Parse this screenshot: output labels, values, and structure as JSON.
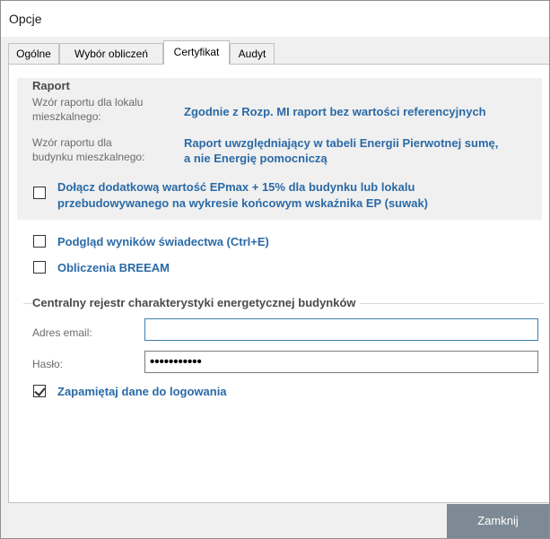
{
  "window": {
    "title": "Opcje"
  },
  "tabs": [
    {
      "label": "Ogólne"
    },
    {
      "label": "Wybór obliczeń"
    },
    {
      "label": "Certyfikat"
    },
    {
      "label": "Audyt"
    }
  ],
  "active_tab": "Certyfikat",
  "raport": {
    "title": "Raport",
    "lokal_label_line1": "Wzór raportu dla lokalu",
    "lokal_label_line2": "mieszkalnego:",
    "lokal_value": "Zgodnie z Rozp. MI raport bez wartości referencyjnych",
    "budynek_label_line1": "Wzór raportu dla",
    "budynek_label_line2": "budynku mieszkalnego:",
    "budynek_value_line1": "Raport uwzględniający w tabeli Energii Pierwotnej sumę,",
    "budynek_value_line2": "a nie Energię pomocniczą",
    "epmax_checkbox": {
      "label_line1": "Dołącz dodatkową wartość EPmax + 15% dla budynku lub lokalu",
      "label_line2": "przebudowywanego na wykresie końcowym wskaźnika EP (suwak)",
      "checked": false
    }
  },
  "preview_checkbox": {
    "label": "Podgląd wyników świadectwa (Ctrl+E)",
    "checked": false
  },
  "breeam_checkbox": {
    "label": "Obliczenia BREEAM",
    "checked": false
  },
  "registry": {
    "title": "Centralny rejestr charakterystyki energetycznej budynków",
    "email_label": "Adres email:",
    "email_value": "",
    "password_label": "Hasło:",
    "password_mask": "•••••••••••",
    "remember_checkbox": {
      "label": "Zapamiętaj dane do logowania",
      "checked": true
    }
  },
  "footer": {
    "close_label": "Zamknij"
  },
  "colors": {
    "link_blue": "#2a6aa6",
    "close_button": "#7d8a95",
    "panel_gray": "#f0f0f0"
  }
}
